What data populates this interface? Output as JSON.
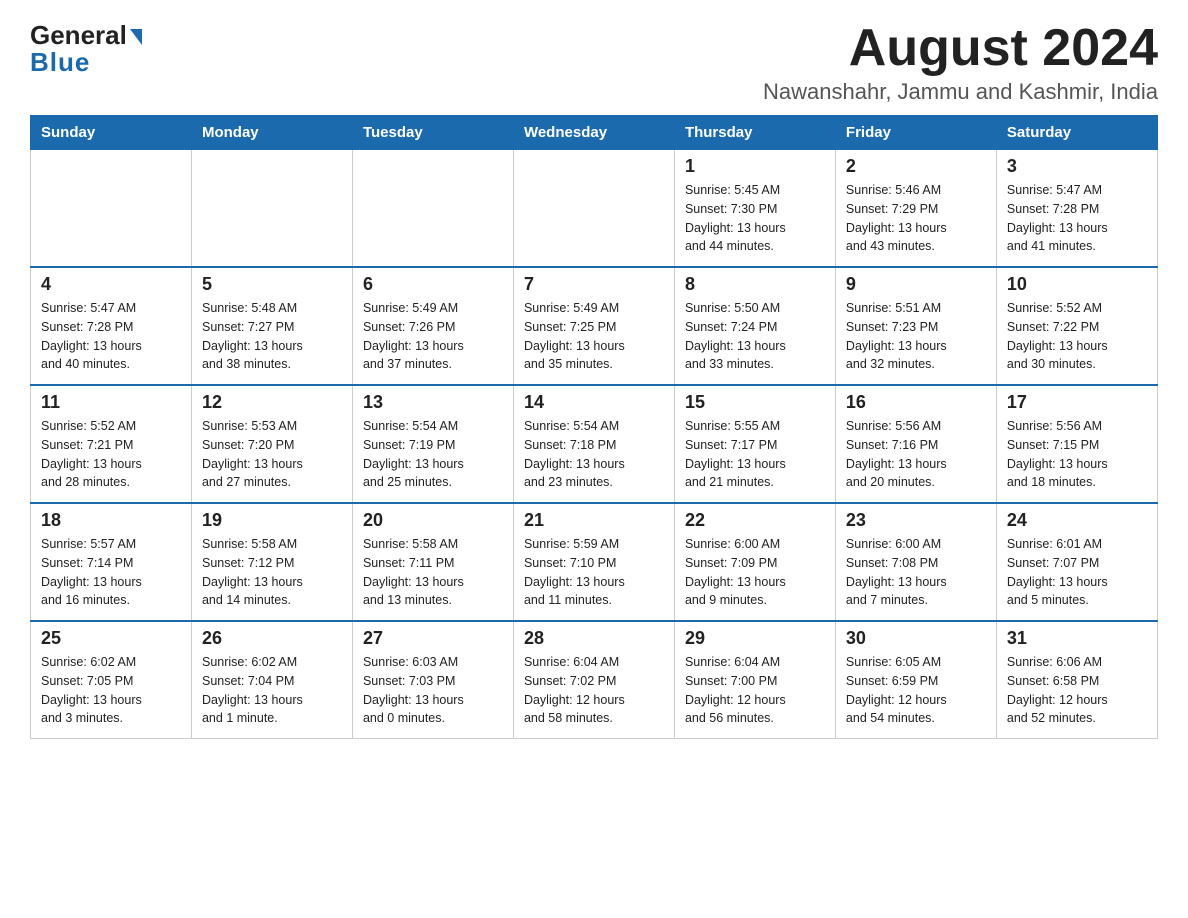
{
  "header": {
    "logo_general": "General",
    "logo_blue": "Blue",
    "title": "August 2024",
    "subtitle": "Nawanshahr, Jammu and Kashmir, India"
  },
  "days_of_week": [
    "Sunday",
    "Monday",
    "Tuesday",
    "Wednesday",
    "Thursday",
    "Friday",
    "Saturday"
  ],
  "weeks": [
    [
      {
        "day": "",
        "info": ""
      },
      {
        "day": "",
        "info": ""
      },
      {
        "day": "",
        "info": ""
      },
      {
        "day": "",
        "info": ""
      },
      {
        "day": "1",
        "info": "Sunrise: 5:45 AM\nSunset: 7:30 PM\nDaylight: 13 hours\nand 44 minutes."
      },
      {
        "day": "2",
        "info": "Sunrise: 5:46 AM\nSunset: 7:29 PM\nDaylight: 13 hours\nand 43 minutes."
      },
      {
        "day": "3",
        "info": "Sunrise: 5:47 AM\nSunset: 7:28 PM\nDaylight: 13 hours\nand 41 minutes."
      }
    ],
    [
      {
        "day": "4",
        "info": "Sunrise: 5:47 AM\nSunset: 7:28 PM\nDaylight: 13 hours\nand 40 minutes."
      },
      {
        "day": "5",
        "info": "Sunrise: 5:48 AM\nSunset: 7:27 PM\nDaylight: 13 hours\nand 38 minutes."
      },
      {
        "day": "6",
        "info": "Sunrise: 5:49 AM\nSunset: 7:26 PM\nDaylight: 13 hours\nand 37 minutes."
      },
      {
        "day": "7",
        "info": "Sunrise: 5:49 AM\nSunset: 7:25 PM\nDaylight: 13 hours\nand 35 minutes."
      },
      {
        "day": "8",
        "info": "Sunrise: 5:50 AM\nSunset: 7:24 PM\nDaylight: 13 hours\nand 33 minutes."
      },
      {
        "day": "9",
        "info": "Sunrise: 5:51 AM\nSunset: 7:23 PM\nDaylight: 13 hours\nand 32 minutes."
      },
      {
        "day": "10",
        "info": "Sunrise: 5:52 AM\nSunset: 7:22 PM\nDaylight: 13 hours\nand 30 minutes."
      }
    ],
    [
      {
        "day": "11",
        "info": "Sunrise: 5:52 AM\nSunset: 7:21 PM\nDaylight: 13 hours\nand 28 minutes."
      },
      {
        "day": "12",
        "info": "Sunrise: 5:53 AM\nSunset: 7:20 PM\nDaylight: 13 hours\nand 27 minutes."
      },
      {
        "day": "13",
        "info": "Sunrise: 5:54 AM\nSunset: 7:19 PM\nDaylight: 13 hours\nand 25 minutes."
      },
      {
        "day": "14",
        "info": "Sunrise: 5:54 AM\nSunset: 7:18 PM\nDaylight: 13 hours\nand 23 minutes."
      },
      {
        "day": "15",
        "info": "Sunrise: 5:55 AM\nSunset: 7:17 PM\nDaylight: 13 hours\nand 21 minutes."
      },
      {
        "day": "16",
        "info": "Sunrise: 5:56 AM\nSunset: 7:16 PM\nDaylight: 13 hours\nand 20 minutes."
      },
      {
        "day": "17",
        "info": "Sunrise: 5:56 AM\nSunset: 7:15 PM\nDaylight: 13 hours\nand 18 minutes."
      }
    ],
    [
      {
        "day": "18",
        "info": "Sunrise: 5:57 AM\nSunset: 7:14 PM\nDaylight: 13 hours\nand 16 minutes."
      },
      {
        "day": "19",
        "info": "Sunrise: 5:58 AM\nSunset: 7:12 PM\nDaylight: 13 hours\nand 14 minutes."
      },
      {
        "day": "20",
        "info": "Sunrise: 5:58 AM\nSunset: 7:11 PM\nDaylight: 13 hours\nand 13 minutes."
      },
      {
        "day": "21",
        "info": "Sunrise: 5:59 AM\nSunset: 7:10 PM\nDaylight: 13 hours\nand 11 minutes."
      },
      {
        "day": "22",
        "info": "Sunrise: 6:00 AM\nSunset: 7:09 PM\nDaylight: 13 hours\nand 9 minutes."
      },
      {
        "day": "23",
        "info": "Sunrise: 6:00 AM\nSunset: 7:08 PM\nDaylight: 13 hours\nand 7 minutes."
      },
      {
        "day": "24",
        "info": "Sunrise: 6:01 AM\nSunset: 7:07 PM\nDaylight: 13 hours\nand 5 minutes."
      }
    ],
    [
      {
        "day": "25",
        "info": "Sunrise: 6:02 AM\nSunset: 7:05 PM\nDaylight: 13 hours\nand 3 minutes."
      },
      {
        "day": "26",
        "info": "Sunrise: 6:02 AM\nSunset: 7:04 PM\nDaylight: 13 hours\nand 1 minute."
      },
      {
        "day": "27",
        "info": "Sunrise: 6:03 AM\nSunset: 7:03 PM\nDaylight: 13 hours\nand 0 minutes."
      },
      {
        "day": "28",
        "info": "Sunrise: 6:04 AM\nSunset: 7:02 PM\nDaylight: 12 hours\nand 58 minutes."
      },
      {
        "day": "29",
        "info": "Sunrise: 6:04 AM\nSunset: 7:00 PM\nDaylight: 12 hours\nand 56 minutes."
      },
      {
        "day": "30",
        "info": "Sunrise: 6:05 AM\nSunset: 6:59 PM\nDaylight: 12 hours\nand 54 minutes."
      },
      {
        "day": "31",
        "info": "Sunrise: 6:06 AM\nSunset: 6:58 PM\nDaylight: 12 hours\nand 52 minutes."
      }
    ]
  ]
}
